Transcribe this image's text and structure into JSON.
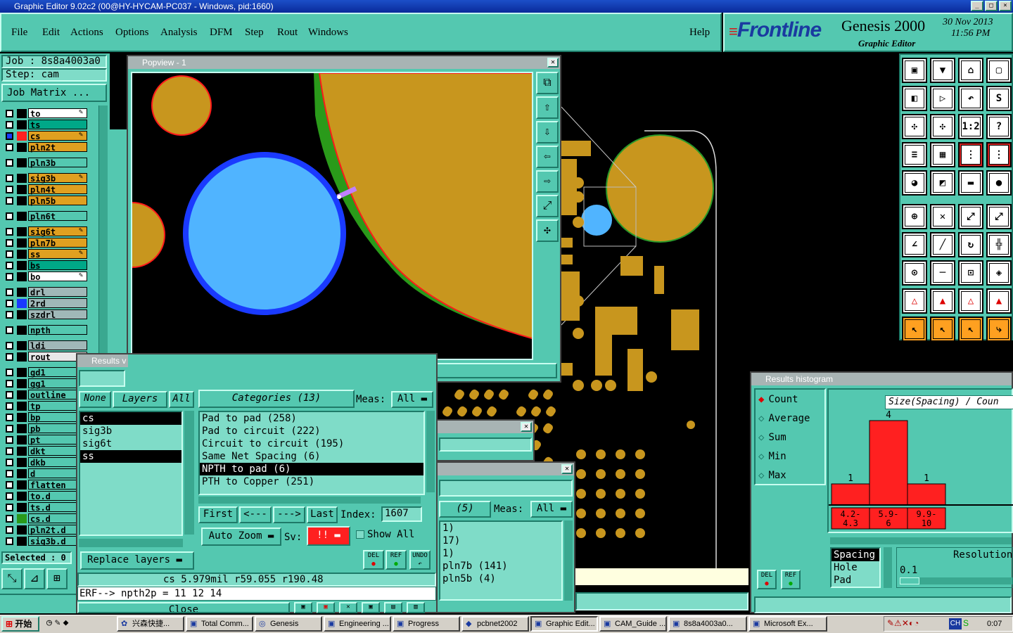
{
  "window_title": "Graphic Editor 9.02c2 (00@HY-HYCAM-PC037 - Windows, pid:1660)",
  "menu": [
    "File",
    "Edit",
    "Actions",
    "Options",
    "Analysis",
    "DFM",
    "Step",
    "Rout",
    "Windows"
  ],
  "help": "Help",
  "brand": {
    "logo": "Frontline",
    "product": "Genesis 2000",
    "subtitle": "Graphic Editor",
    "date": "30 Nov 2013",
    "time": "11:56 PM"
  },
  "job": {
    "job_label": "Job : 8s8a4003a0",
    "step_label": "Step: cam",
    "matrix_button": "Job Matrix ..."
  },
  "layers": [
    {
      "name": "to",
      "color": "#ffffff",
      "mark": "✎"
    },
    {
      "name": "ts",
      "color": "#00a888",
      "mark": ""
    },
    {
      "name": "cs",
      "color": "#e0a020",
      "mark": "✎",
      "active": true
    },
    {
      "name": "pln2t",
      "color": "#e0a020",
      "mark": ""
    },
    {
      "name": "pln3b",
      "color": "#54c8b0",
      "mark": ""
    },
    {
      "name": "sig3b",
      "color": "#e0a020",
      "mark": "✎"
    },
    {
      "name": "pln4t",
      "color": "#e0a020",
      "mark": ""
    },
    {
      "name": "pln5b",
      "color": "#e0a020",
      "mark": ""
    },
    {
      "name": "pln6t",
      "color": "#54c8b0",
      "mark": ""
    },
    {
      "name": "sig6t",
      "color": "#e0a020",
      "mark": "✎"
    },
    {
      "name": "pln7b",
      "color": "#e0a020",
      "mark": ""
    },
    {
      "name": "ss",
      "color": "#e0a020",
      "mark": "✎"
    },
    {
      "name": "bs",
      "color": "#00a888",
      "mark": ""
    },
    {
      "name": "bo",
      "color": "#ffffff",
      "mark": "✎"
    },
    {
      "name": "drl",
      "color": "#a0b8b8",
      "mark": ""
    },
    {
      "name": "2rd",
      "color": "#a0b8b8",
      "mark": ""
    },
    {
      "name": "szdrl",
      "color": "#a0b8b8",
      "mark": ""
    },
    {
      "name": "npth",
      "color": "#54c8b0",
      "mark": ""
    },
    {
      "name": "ldi",
      "color": "#a0b8b8",
      "mark": ""
    },
    {
      "name": "rout",
      "color": "#e8e8e8",
      "mark": ""
    },
    {
      "name": "gd1",
      "color": "#54c8b0",
      "mark": ""
    },
    {
      "name": "gg1",
      "color": "#54c8b0",
      "mark": ""
    },
    {
      "name": "outline",
      "color": "#54c8b0",
      "mark": ""
    },
    {
      "name": "tp",
      "color": "#54c8b0",
      "mark": ""
    },
    {
      "name": "bp",
      "color": "#54c8b0",
      "mark": ""
    },
    {
      "name": "pb",
      "color": "#54c8b0",
      "mark": ""
    },
    {
      "name": "pt",
      "color": "#54c8b0",
      "mark": ""
    },
    {
      "name": "dkt",
      "color": "#54c8b0",
      "mark": ""
    },
    {
      "name": "dkb",
      "color": "#54c8b0",
      "mark": ""
    },
    {
      "name": "d",
      "color": "#54c8b0",
      "mark": ""
    },
    {
      "name": "flatten",
      "color": "#54c8b0",
      "mark": ""
    },
    {
      "name": "to.d",
      "color": "#54c8b0",
      "mark": ""
    },
    {
      "name": "ts.d",
      "color": "#54c8b0",
      "mark": ""
    },
    {
      "name": "cs.d",
      "color": "#54c8b0",
      "mark": ""
    },
    {
      "name": "pln2t.d",
      "color": "#54c8b0",
      "mark": ""
    },
    {
      "name": "sig3b.d",
      "color": "#54c8b0",
      "mark": ""
    }
  ],
  "selected_label": "Selected : 0",
  "popview": {
    "title": "Popview - 1",
    "close": "Close"
  },
  "results_viewer": {
    "title": "Results v",
    "none": "None",
    "layers": "Layers",
    "all": "All",
    "layer_list": [
      "cs",
      "sig3b",
      "sig6t",
      "ss"
    ],
    "categories_label": "Categories (13)",
    "meas_label": "Meas:",
    "meas_value": "All",
    "categories": [
      "Pad to pad (258)",
      "Pad to circuit (222)",
      "Circuit to circuit (195)",
      "Same Net Spacing (6)",
      "NPTH to pad (6)",
      "PTH to Copper (251)"
    ],
    "first": "First",
    "prev": "<---",
    "next": "--->",
    "last": "Last",
    "index_label": "Index:",
    "index_value": "1607",
    "auto_zoom": "Auto Zoom",
    "sv_label": "Sv:",
    "sv_value": "!!",
    "show_all": "Show All",
    "replace_layers": "Replace layers",
    "del": "DEL",
    "ref": "REF",
    "undo": "UNDO",
    "status": "cs 5.979mil   r59.055  r190.48",
    "erf": "ERF--> npth2p = 11 12 14",
    "close": "Close"
  },
  "results_behind": {
    "count_label": "(5)",
    "meas_label": "Meas:",
    "meas_value": "All",
    "items": [
      "1)",
      "17)",
      "1)",
      "pln7b (141)",
      "pln5b (4)"
    ]
  },
  "histogram": {
    "title": "Results histogram",
    "options": [
      "Count",
      "Average",
      "Sum",
      "Min",
      "Max"
    ],
    "chart_title": "Size(Spacing) / Coun",
    "list": [
      "Spacing",
      "Hole",
      "Pad"
    ],
    "resolution_label": "Resolution",
    "resolution_value": "0.1",
    "del": "DEL",
    "ref": "REF"
  },
  "chart_data": {
    "type": "bar",
    "title": "Size(Spacing) / Coun",
    "categories": [
      "4.2-4.3",
      "5.9-6",
      "9.9-10"
    ],
    "values": [
      1,
      4,
      1
    ],
    "ylim": [
      0,
      4
    ]
  },
  "taskbar": {
    "start": "开始",
    "items": [
      "兴森快捷...",
      "Total Comm...",
      "Genesis",
      "Engineering ...",
      "Progress",
      "pcbnet2002",
      "Graphic Edit...",
      "CAM_Guide ...",
      "8s8a4003a0...",
      "Microsoft Ex..."
    ],
    "clock": "0:07",
    "lang": "CH"
  },
  "colors": {
    "panel": "#54c8b0",
    "copper": "#c8961e",
    "drill": "#50b4ff",
    "red": "#ff2020"
  }
}
